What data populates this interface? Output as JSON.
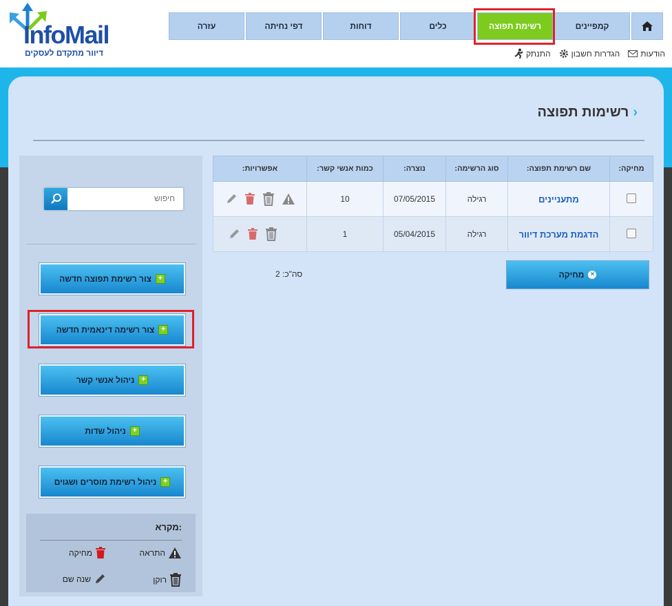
{
  "logo": {
    "text": "InfoMail",
    "tagline": "דיוור מתקדם לעסקים"
  },
  "nav": {
    "home_icon": "home-icon",
    "tabs": [
      "קמפיינים",
      "רשימת תפוצה",
      "כלים",
      "דוחות",
      "דפי נחיתה",
      "עזרה"
    ],
    "active_tab": "רשימת תפוצה"
  },
  "toplinks": {
    "messages": "הודעות",
    "settings": "הגדרות חשבון",
    "logout": "התנתק"
  },
  "page": {
    "title": "רשימות תפוצה"
  },
  "search": {
    "placeholder": "חיפוש"
  },
  "sidebar": {
    "buttons": [
      "צור רשימת תפוצה חדשה",
      "צור רשימה דינאמית חדשה",
      "ניהול אנשי קשר",
      "ניהול שדות",
      "ניהול רשימת מוסרים ושגוים"
    ]
  },
  "legend": {
    "title": "מקרא:",
    "warning": "התראה",
    "delete": "מחיקה",
    "empty": "רוקן",
    "rename": "שנה שם"
  },
  "table": {
    "headers": [
      "מחיקה:",
      "שם רשימת תפוצה:",
      "סוג הרשימה:",
      "נוצרה:",
      "כמות אנשי קשר:",
      "אפשרויות:"
    ],
    "rows": [
      {
        "name": "מתעניינים",
        "type": "רגילה",
        "created": "07/05/2015",
        "count": "10"
      },
      {
        "name": "הדגמת מערכת דיוור",
        "type": "רגילה",
        "created": "05/04/2015",
        "count": "1"
      }
    ]
  },
  "actions": {
    "delete_label": "מחיקה",
    "total": "סה\"כ: 2"
  },
  "colors": {
    "accent": "#1eb6ea",
    "active_tab": "#7dcb1f",
    "highlight": "#e0212a",
    "link": "#1d5fc2"
  }
}
